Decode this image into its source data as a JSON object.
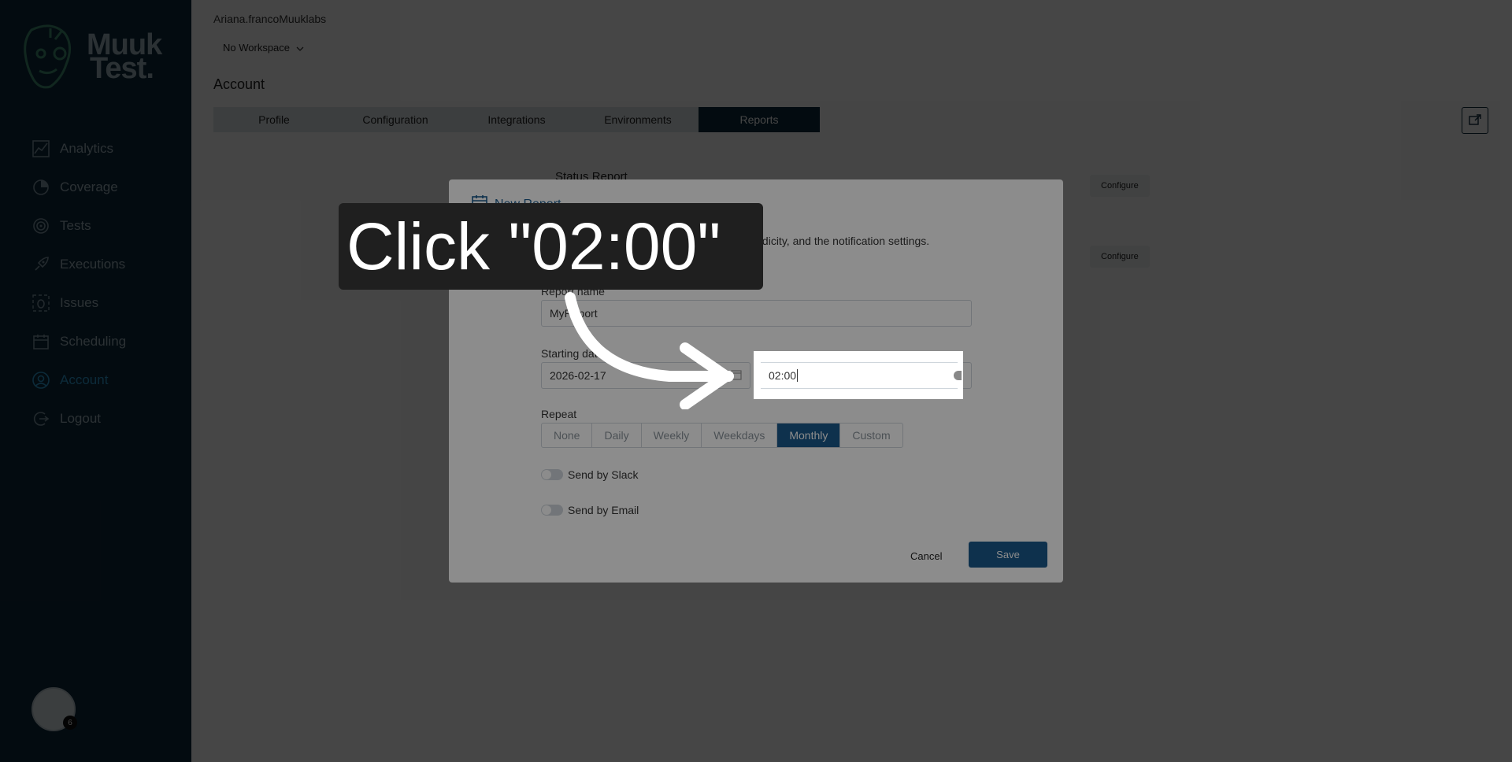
{
  "sidebar": {
    "logo_text_line1": "Muuk",
    "logo_text_line2": "Test.",
    "items": [
      {
        "label": "Analytics",
        "icon": "analytics-icon"
      },
      {
        "label": "Coverage",
        "icon": "coverage-icon"
      },
      {
        "label": "Tests",
        "icon": "tests-icon"
      },
      {
        "label": "Executions",
        "icon": "rocket-icon"
      },
      {
        "label": "Issues",
        "icon": "bug-icon"
      },
      {
        "label": "Scheduling",
        "icon": "calendar-icon"
      },
      {
        "label": "Account",
        "icon": "user-icon",
        "active": true
      },
      {
        "label": "Logout",
        "icon": "logout-icon"
      }
    ],
    "avatar_badge": "6"
  },
  "header": {
    "username": "Ariana.francoMuuklabs",
    "workspace": "No Workspace",
    "page_title": "Account"
  },
  "tabs": [
    "Profile",
    "Configuration",
    "Integrations",
    "Environments",
    "Reports"
  ],
  "active_tab": "Reports",
  "reports": [
    {
      "name": "Status Report",
      "action": "Configure"
    },
    {
      "name": "",
      "action": "Configure"
    }
  ],
  "modal": {
    "title": "New Report",
    "description": "ndicate report name and time to save it, periodicity, and the notification settings.",
    "report_name_label": "Report name",
    "report_name_value": "MyReport",
    "starting_date_label": "Starting date",
    "starting_date_value": "2026-02-17",
    "time_value": "02:00",
    "repeat_label": "Repeat",
    "repeat_options": [
      "None",
      "Daily",
      "Weekly",
      "Weekdays",
      "Monthly",
      "Custom"
    ],
    "repeat_selected": "Monthly",
    "send_by_slack": "Send by Slack",
    "send_by_email": "Send by Email",
    "cancel": "Cancel",
    "save": "Save"
  },
  "callout": {
    "text": "Click \"02:00\""
  },
  "colors": {
    "sidebar_bg": "#0f2a3c",
    "accent": "#1a5a8c",
    "active_link": "#2f9fd6"
  }
}
